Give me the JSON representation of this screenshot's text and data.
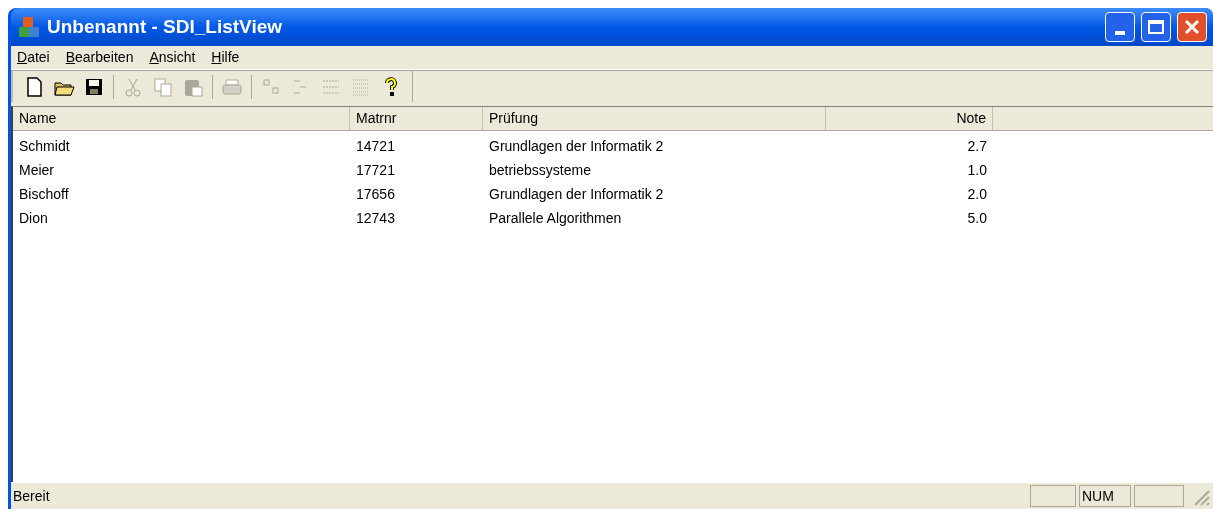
{
  "window": {
    "title": "Unbenannt - SDI_ListView"
  },
  "menu": [
    "Datei",
    "Bearbeiten",
    "Ansicht",
    "Hilfe"
  ],
  "toolbar": [
    {
      "kind": "new",
      "disabled": false
    },
    {
      "kind": "open",
      "disabled": false
    },
    {
      "kind": "save",
      "disabled": false
    },
    {
      "kind": "separator"
    },
    {
      "kind": "cut",
      "disabled": true
    },
    {
      "kind": "copy",
      "disabled": true
    },
    {
      "kind": "paste",
      "disabled": true
    },
    {
      "kind": "separator"
    },
    {
      "kind": "print",
      "disabled": true
    },
    {
      "kind": "separator"
    },
    {
      "kind": "large-icons",
      "disabled": true
    },
    {
      "kind": "small-icons",
      "disabled": true
    },
    {
      "kind": "list",
      "disabled": true
    },
    {
      "kind": "details",
      "disabled": true
    },
    {
      "kind": "help",
      "disabled": false
    }
  ],
  "table": {
    "columns": [
      {
        "label": "Name"
      },
      {
        "label": "Matrnr"
      },
      {
        "label": "Prüfung"
      },
      {
        "label": "Note"
      }
    ],
    "rows": [
      [
        "Schmidt",
        "14721",
        "Grundlagen der Informatik 2",
        "2.7"
      ],
      [
        "Meier",
        "17721",
        "betriebssysteme",
        "1.0"
      ],
      [
        "Bischoff",
        "17656",
        "Grundlagen der Informatik 2",
        "2.0"
      ],
      [
        "Dion",
        "12743",
        "Parallele Algorithmen",
        "5.0"
      ]
    ]
  },
  "status_bar": {
    "text": "Bereit",
    "indicators": [
      "NUM"
    ]
  }
}
